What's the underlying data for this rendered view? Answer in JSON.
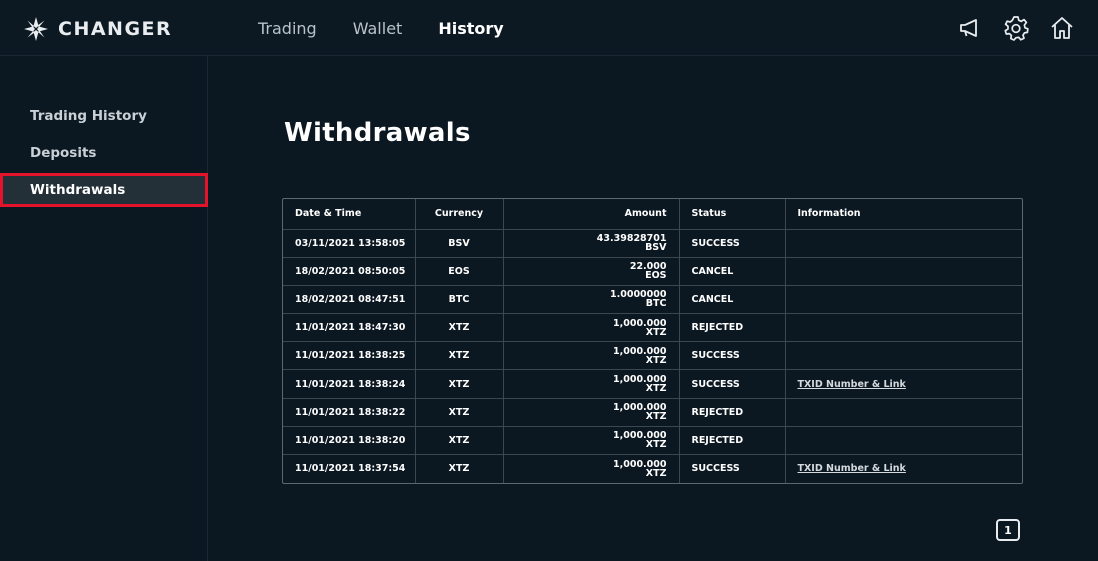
{
  "app": {
    "brand": "CHANGER"
  },
  "nav": {
    "items": [
      {
        "label": "Trading",
        "active": false
      },
      {
        "label": "Wallet",
        "active": false
      },
      {
        "label": "History",
        "active": true
      }
    ]
  },
  "header_icons": [
    "megaphone-icon",
    "gear-icon",
    "home-icon"
  ],
  "sidebar": {
    "items": [
      {
        "label": "Trading History",
        "active": false
      },
      {
        "label": "Deposits",
        "active": false
      },
      {
        "label": "Withdrawals",
        "active": true
      }
    ]
  },
  "main": {
    "title": "Withdrawals"
  },
  "table": {
    "headers": [
      "Date & Time",
      "Currency",
      "Amount",
      "Status",
      "Information"
    ],
    "rows": [
      {
        "date": "03/11/2021 13:58:05",
        "currency": "BSV",
        "amount": "43.39828701",
        "unit": "BSV",
        "status": "SUCCESS",
        "info": ""
      },
      {
        "date": "18/02/2021 08:50:05",
        "currency": "EOS",
        "amount": "22.000",
        "unit": "EOS",
        "status": "CANCEL",
        "info": ""
      },
      {
        "date": "18/02/2021 08:47:51",
        "currency": "BTC",
        "amount": "1.0000000",
        "unit": "BTC",
        "status": "CANCEL",
        "info": ""
      },
      {
        "date": "11/01/2021 18:47:30",
        "currency": "XTZ",
        "amount": "1,000.000",
        "unit": "XTZ",
        "status": "REJECTED",
        "info": ""
      },
      {
        "date": "11/01/2021 18:38:25",
        "currency": "XTZ",
        "amount": "1,000.000",
        "unit": "XTZ",
        "status": "SUCCESS",
        "info": ""
      },
      {
        "date": "11/01/2021 18:38:24",
        "currency": "XTZ",
        "amount": "1,000.000",
        "unit": "XTZ",
        "status": "SUCCESS",
        "info": "TXID Number & Link"
      },
      {
        "date": "11/01/2021 18:38:22",
        "currency": "XTZ",
        "amount": "1,000.000",
        "unit": "XTZ",
        "status": "REJECTED",
        "info": ""
      },
      {
        "date": "11/01/2021 18:38:20",
        "currency": "XTZ",
        "amount": "1,000.000",
        "unit": "XTZ",
        "status": "REJECTED",
        "info": ""
      },
      {
        "date": "11/01/2021 18:37:54",
        "currency": "XTZ",
        "amount": "1,000.000",
        "unit": "XTZ",
        "status": "SUCCESS",
        "info": "TXID Number & Link"
      }
    ]
  },
  "pagination": {
    "current_page": "1"
  },
  "colors": {
    "background": "#0b1721",
    "highlight_border": "#e5122b",
    "active_item_bg": "#233038"
  }
}
